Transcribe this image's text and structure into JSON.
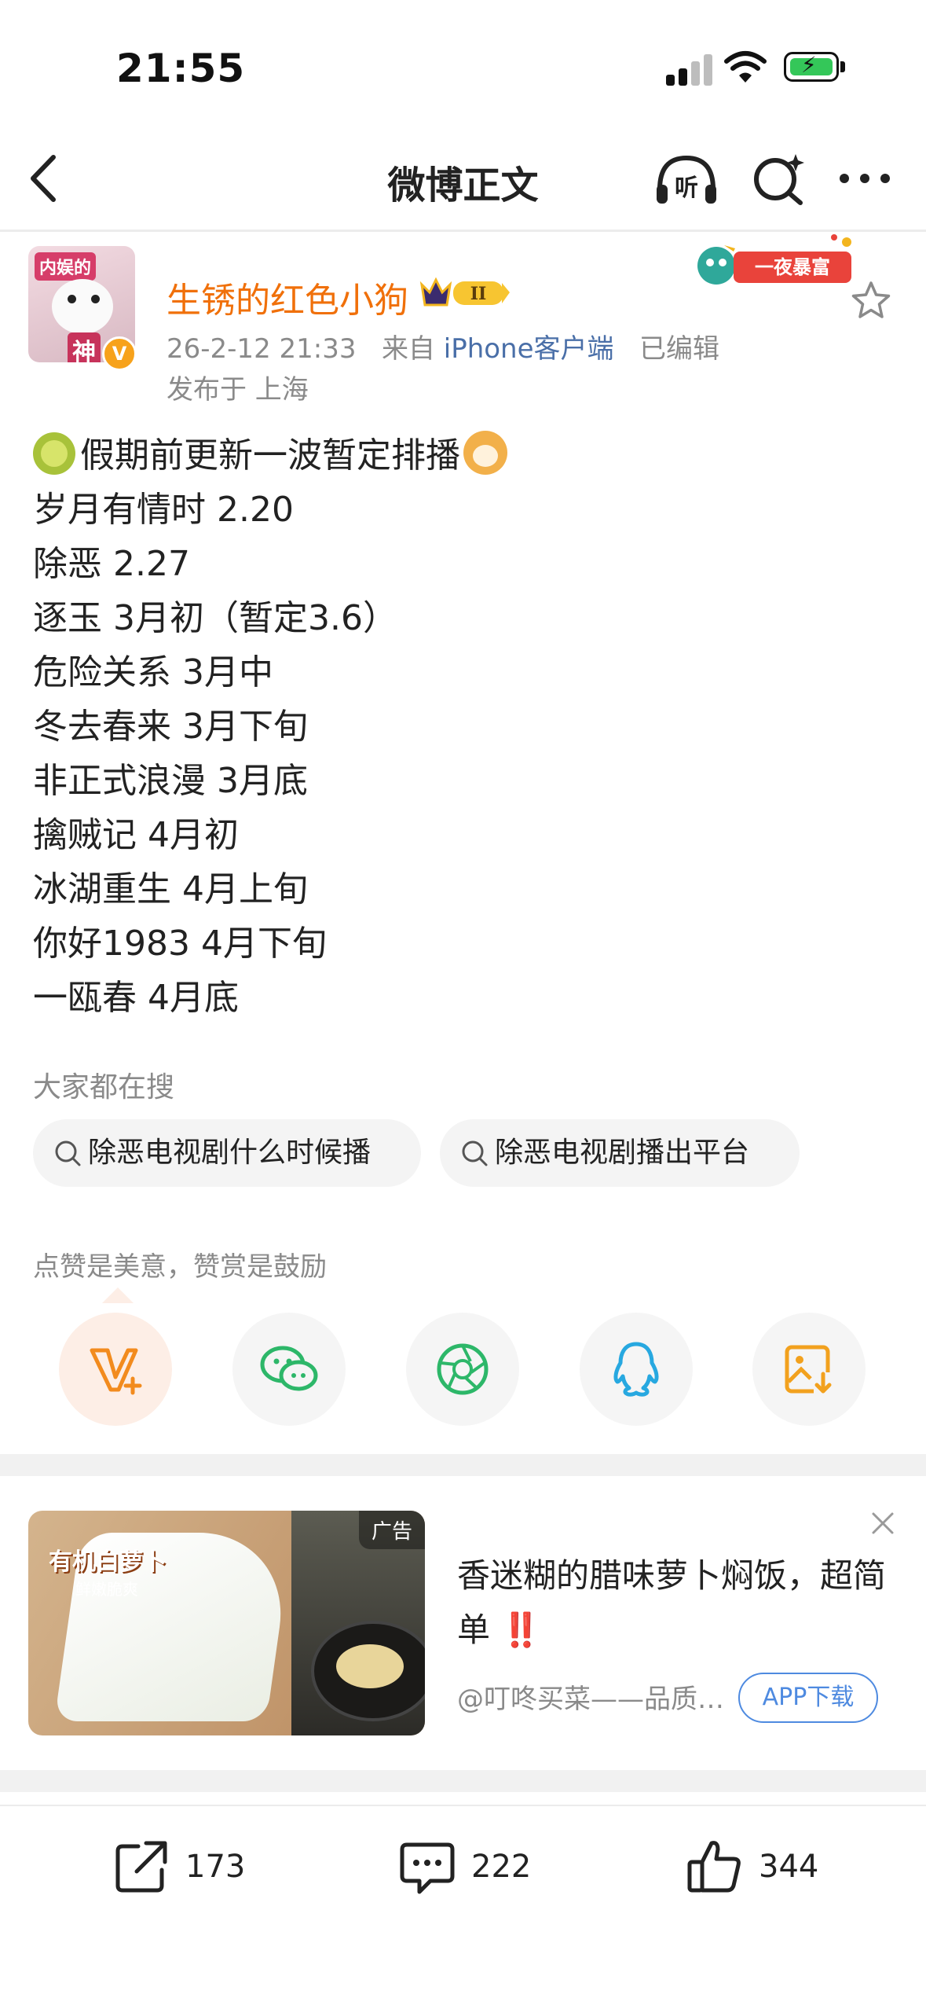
{
  "status_bar": {
    "time": "21:55"
  },
  "nav": {
    "title": "微博正文",
    "listen_label": "听"
  },
  "post": {
    "avatar_tag": "内娱的",
    "avatar_god": "神",
    "username": "生锈的红色小狗",
    "vip_level": "II",
    "date": "26-2-12 21:33",
    "from_prefix": "来自",
    "source": "iPhone客户端",
    "edited": "已编辑",
    "location": "发布于 上海",
    "deco_badge": "一夜暴富",
    "lines": [
      "假期前更新一波暂定排播",
      "岁月有情时 2.20",
      "除恶 2.27",
      "逐玉 3月初（暂定3.6）",
      "危险关系 3月中",
      "冬去春来 3月下旬",
      "非正式浪漫 3月底",
      "擒贼记 4月初",
      "冰湖重生 4月上旬",
      "你好1983 4月下旬",
      "一瓯春 4月底"
    ]
  },
  "searches": {
    "heading": "大家都在搜",
    "chips": [
      "除恶电视剧什么时候播",
      "除恶电视剧播出平台"
    ]
  },
  "reward": {
    "text": "点赞是美意，赞赏是鼓励",
    "share_targets": [
      "reward",
      "wechat",
      "moments",
      "qq",
      "save-image"
    ]
  },
  "ad": {
    "badge": "广告",
    "image_title": "有机白萝卜",
    "image_subtitle": "鲜嫩脆爽",
    "title": "香迷糊的腊味萝卜焖饭，超简单",
    "bang": "‼️",
    "source": "@叮咚买菜——品质生活",
    "app_button": "APP下载"
  },
  "actions": {
    "repost": "173",
    "comment": "222",
    "like": "344"
  },
  "colors": {
    "username": "#f0700a",
    "link": "#4a6fa8",
    "app_button": "#4e8ae0",
    "battery": "#34c759"
  }
}
